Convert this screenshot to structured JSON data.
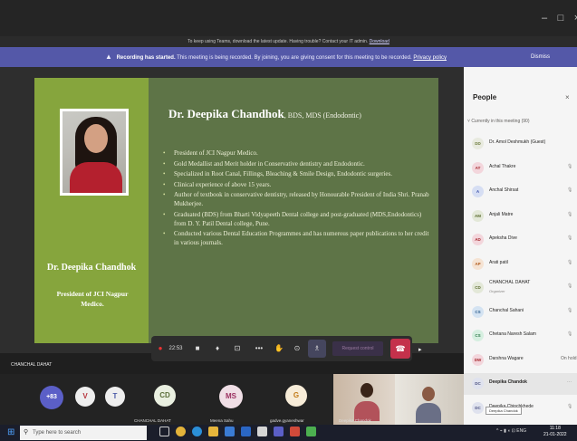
{
  "window": {
    "minimize_icon": "–",
    "maximize_icon": "□",
    "close_icon": "×"
  },
  "update_banner": {
    "text": "To keep using Teams, download the latest update. Having trouble? Contact your IT admin.",
    "link": "Download"
  },
  "recording_banner": {
    "bold": "Recording has started.",
    "text": "This meeting is being recorded. By joining, you are giving consent for this meeting to be recorded.",
    "link": "Privacy policy",
    "dismiss": "Dismiss",
    "color": "#5458a8"
  },
  "slide": {
    "left_name": "Dr. Deepika Chandhok",
    "left_role": "President of JCI Nagpur Medico.",
    "title": "Dr. Deepika Chandhok",
    "credentials": ", BDS, MDS (Endodontic)",
    "bullets": [
      "President of JCI Nagpur Medico.",
      "Gold Medallist and Merit holder in Conservative dentistry and Endodontic.",
      "Specialized in Root Canal, Fillings, Bleaching & Smile Design, Endodontic surgeries.",
      "Clinical experience of above 15 years.",
      "Author of textbook in conservative dentistry, released by Honourable President of India Shri. Pranab Mukherjee.",
      "Graduated (BDS) from Bharti Vidyapeeth Dental college and post-graduated (MDS,Endodontics) from D. Y. Patil Dental college, Pune.",
      "Conducted various Dental Education Programmes and has numerous paper publications to her credit in various journals."
    ],
    "colors": {
      "main": "#5e7447",
      "left": "#86a53d"
    }
  },
  "callbar": {
    "record_icon": "●",
    "time": "22:53",
    "video_icon": "■",
    "mic_icon": "♦",
    "share_icon": "⊡",
    "more_icon": "•••",
    "hand_icon": "✋",
    "chat_icon": "⊙",
    "people_icon": "♗",
    "request_control": "Request control",
    "hangup_icon": "☎"
  },
  "stage_label": "CHANCHAL DAHAT",
  "strip": {
    "overflow_count": "+83",
    "avatars": [
      "V",
      "T",
      "CD",
      "MS",
      "G"
    ],
    "names": [
      "CHANCHAL DAHAT",
      "Meena Sahu",
      "gadve.gyaneshwar",
      "Deepika Chandok"
    ]
  },
  "people_panel": {
    "title": "People",
    "close_icon": "×",
    "section": "Currently in this meeting (90)",
    "participants": [
      {
        "initials": "DD",
        "name": "Dr. Amol Deshmukh (Guest)",
        "subtitle": "",
        "status": "",
        "bg": "#e8eadf",
        "fg": "#6b7a3a",
        "mic": ""
      },
      {
        "initials": "AT",
        "name": "Achal Thakre",
        "subtitle": "",
        "status": "",
        "bg": "#f3d6dc",
        "fg": "#a4262c",
        "mic": "🎙"
      },
      {
        "initials": "A",
        "name": "Anchal Shirsat",
        "subtitle": "",
        "status": "",
        "bg": "#d6def3",
        "fg": "#3b4fa8",
        "mic": "🎙"
      },
      {
        "initials": "AM",
        "name": "Anjali Matre",
        "subtitle": "",
        "status": "",
        "bg": "#e3e8d8",
        "fg": "#5a6b2e",
        "mic": "🎙"
      },
      {
        "initials": "AD",
        "name": "Apeksha Dive",
        "subtitle": "",
        "status": "",
        "bg": "#f3d6dc",
        "fg": "#a4262c",
        "mic": "🎙"
      },
      {
        "initials": "AP",
        "name": "Arati patil",
        "subtitle": "",
        "status": "",
        "bg": "#f5e3d3",
        "fg": "#b05a1c",
        "mic": "🎙"
      },
      {
        "initials": "CD",
        "name": "CHANCHAL DAHAT",
        "subtitle": "Organizer",
        "status": "",
        "bg": "#e3e8d8",
        "fg": "#5a6b2e",
        "mic": "🎙"
      },
      {
        "initials": "CS",
        "name": "Chanchal Sahani",
        "subtitle": "",
        "status": "",
        "bg": "#d4e3f2",
        "fg": "#2b5b8a",
        "mic": "🎙"
      },
      {
        "initials": "CS",
        "name": "Chetana Naresh Salam",
        "subtitle": "",
        "status": "",
        "bg": "#d6efe0",
        "fg": "#2e7a4a",
        "mic": "🎙"
      },
      {
        "initials": "DW",
        "name": "Darshna Wagare",
        "subtitle": "",
        "status": "On hold",
        "bg": "#f3d6dc",
        "fg": "#a4262c",
        "mic": ""
      },
      {
        "initials": "DC",
        "name": "Deepika Chandok",
        "subtitle": "",
        "status": "",
        "bg": "#dfe2ee",
        "fg": "#4a5080",
        "mic": "···",
        "active": true
      },
      {
        "initials": "DC",
        "name": "Deepika Chinchkhede",
        "subtitle": "",
        "status": "",
        "bg": "#dfe2ee",
        "fg": "#4a5080",
        "mic": "🎙"
      }
    ],
    "tooltip": "Deepika Chandok"
  },
  "taskbar": {
    "start_icon": "⊞",
    "search_placeholder": "Type here to search",
    "search_icon": "⚲",
    "tray": "^ ⌁ ▮ ◖ ⊡ ENG",
    "time": "11:18",
    "date": "21-01-2022"
  }
}
